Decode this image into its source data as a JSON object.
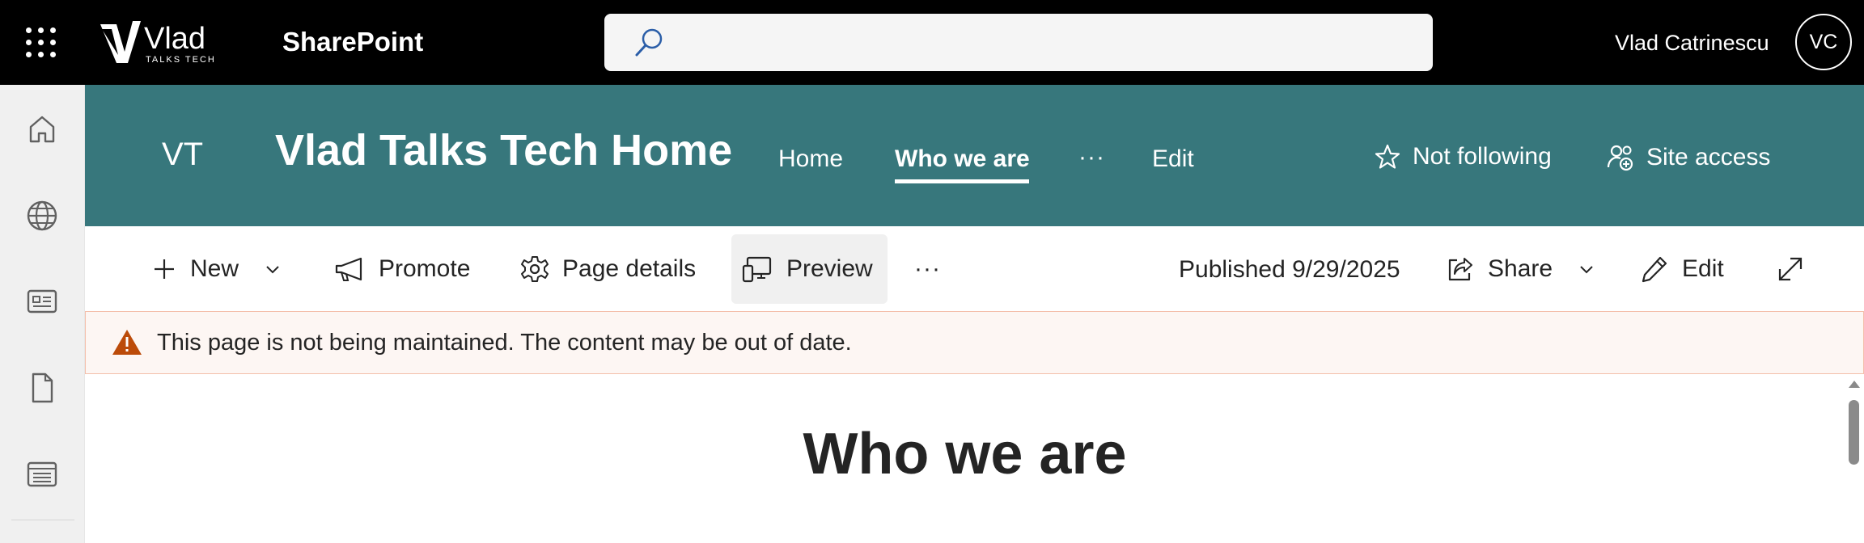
{
  "suitebar": {
    "app_name": "SharePoint",
    "logo_text": "Vlad",
    "logo_subtext": "TALKS TECH",
    "search_value": "",
    "user_name": "Vlad Catrinescu",
    "user_initials": "VC",
    "icons": [
      "app-launcher-icon",
      "search-icon"
    ]
  },
  "left_rail": {
    "items": [
      {
        "icon": "home-icon"
      },
      {
        "icon": "globe-icon"
      },
      {
        "icon": "news-icon"
      },
      {
        "icon": "document-icon"
      },
      {
        "icon": "list-icon"
      }
    ]
  },
  "site_header": {
    "initials": "VT",
    "title": "Vlad Talks Tech Home",
    "nav": [
      {
        "label": "Home",
        "active": false
      },
      {
        "label": "Who we are",
        "active": true
      }
    ],
    "nav_more": "···",
    "nav_edit": "Edit",
    "follow_label": "Not following",
    "site_access_label": "Site access",
    "background_color": "#37777c"
  },
  "command_bar": {
    "new_label": "New",
    "promote_label": "Promote",
    "page_details_label": "Page details",
    "preview_label": "Preview",
    "more_label": "···",
    "published_label": "Published 9/29/2025",
    "share_label": "Share",
    "edit_label": "Edit"
  },
  "banner": {
    "message": "This page is not being maintained. The content may be out of date.",
    "icon": "warning-icon",
    "icon_color": "#bc4b09"
  },
  "content": {
    "page_title": "Who we are"
  }
}
